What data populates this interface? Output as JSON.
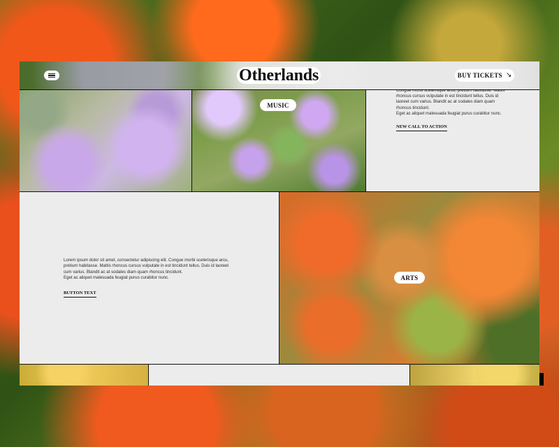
{
  "header": {
    "logo": "Otherlands",
    "buy_tickets": "BUY TICKETS",
    "menu_icon": "hamburger-menu-icon",
    "arrow_icon": "arrow-down-right-icon"
  },
  "panels": {
    "music_label": "MUSIC",
    "arts_label": "ARTS",
    "top_text": [
      "Congue morbi scelerisque arcu, pretium habitasse. Mattis",
      "rhoncus cursus vulputate in est tincidunt tellus. Duis id",
      "laoreet cum varius. Blandit ac at sodales diam quam",
      "rhoncus tincidunt.",
      "Eget ac aliquet malesuada feugiat purus curabitur nunc."
    ],
    "top_cta": "NEW CALL TO ACTION",
    "mid_text": [
      "Lorem ipsum dolor sit amet, consectetur adipiscing elit. Congue morbi scelerisque arcu,",
      "pretium habitasse. Mattis rhoncus cursus vulputate in est tincidunt tellus. Duis id laoreet",
      "cum varius. Blandit ac at sodales diam quam rhoncus tincidunt.",
      "Eget ac aliquet malesuada feugiat purus curabitur nunc."
    ],
    "mid_button": "BUTTON TEXT"
  },
  "colors": {
    "frame_bg": "#ececec",
    "text": "#111111"
  }
}
